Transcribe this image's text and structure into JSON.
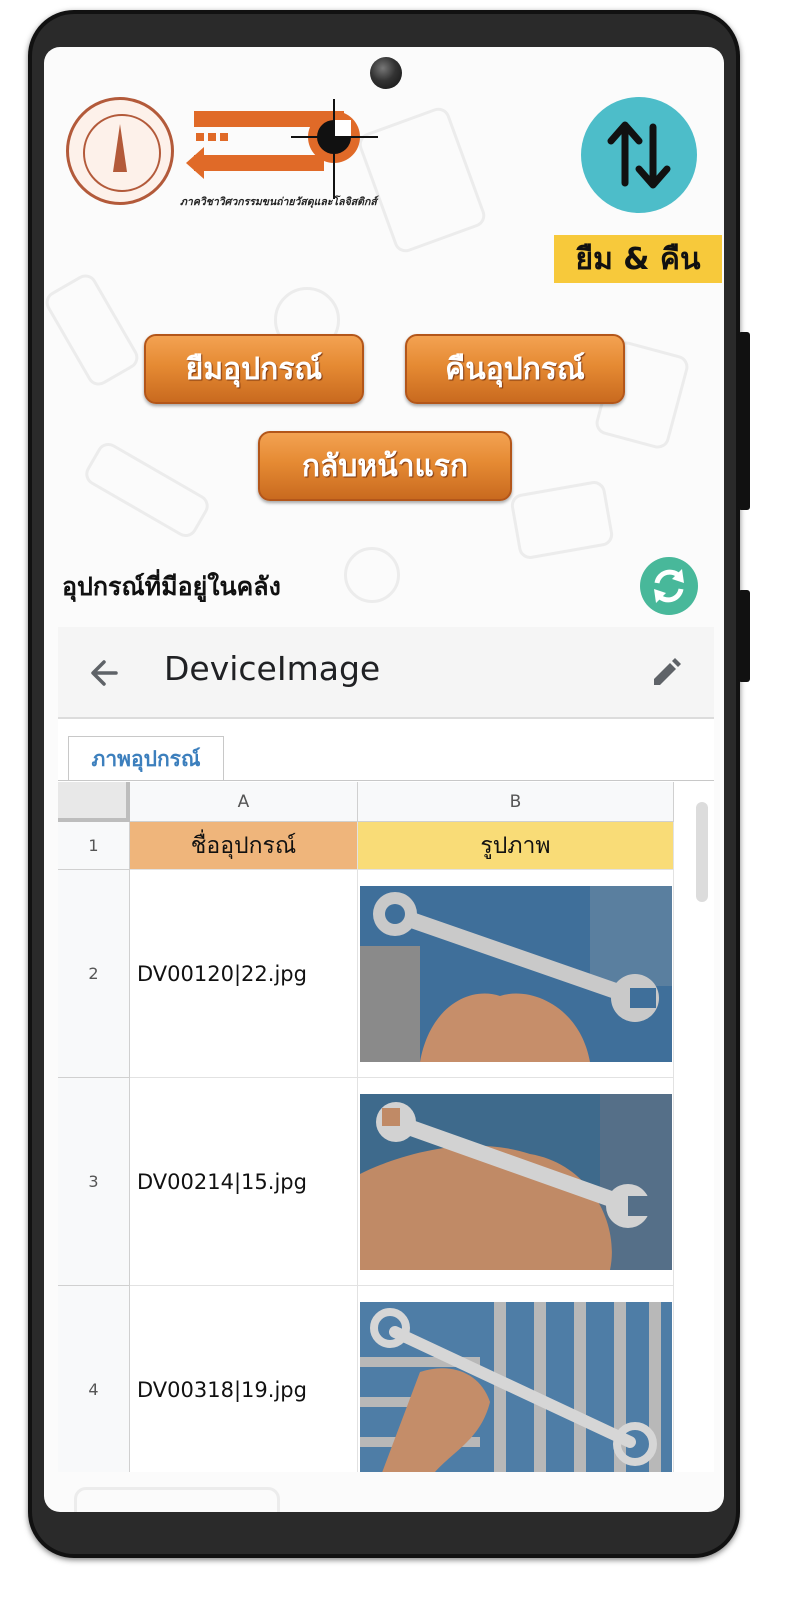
{
  "header": {
    "department_caption": "ภาควิชาวิศวกรรมขนถ่ายวัสดุและโลจิสติกส์",
    "brand_badge": "ยืม & คืน"
  },
  "actions": {
    "borrow_label": "ยืมอุปกรณ์",
    "return_label": "คืนอุปกรณ์",
    "home_label": "กลับหน้าแรก"
  },
  "inventory": {
    "section_title": "อุปกรณ์ที่มีอยู่ในคลัง"
  },
  "sheet": {
    "title": "DeviceImage",
    "tab_label": "ภาพอุปกรณ์",
    "columns": [
      "A",
      "B"
    ],
    "header_row": {
      "row_number": "1",
      "col_a": "ชื่ออุปกรณ์",
      "col_b": "รูปภาพ"
    },
    "rows": [
      {
        "row_number": "2",
        "name": "DV00120|22.jpg"
      },
      {
        "row_number": "3",
        "name": "DV00214|15.jpg"
      },
      {
        "row_number": "4",
        "name": "DV00318|19.jpg"
      }
    ],
    "colors": {
      "col_a_header": "#efb57b",
      "col_b_header": "#f9dc77",
      "tab_text": "#3c7fbd"
    }
  },
  "colors": {
    "accent_orange": "#e58a33",
    "swap_circle": "#4dbdc9",
    "badge_yellow": "#f7c93b",
    "refresh": "#48b89a"
  },
  "icons": [
    "seal-logo",
    "department-logo",
    "swap-arrows-icon",
    "refresh-icon",
    "back-arrow-icon",
    "edit-pencil-icon"
  ]
}
